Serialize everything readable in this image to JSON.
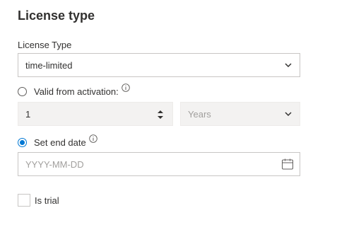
{
  "section": {
    "title": "License type"
  },
  "license_type": {
    "label": "License Type",
    "selected": "time-limited"
  },
  "valid_from_activation": {
    "label": "Valid from activation:",
    "checked": false,
    "amount": "1",
    "unit_selected": "Years"
  },
  "set_end_date": {
    "label": "Set end date",
    "checked": true,
    "placeholder": "YYYY-MM-DD"
  },
  "is_trial": {
    "label": "Is trial",
    "checked": false
  },
  "colors": {
    "accent": "#0078d4",
    "border": "#c8c6c4",
    "disabled_bg": "#f3f2f1",
    "placeholder": "#a19f9d"
  }
}
